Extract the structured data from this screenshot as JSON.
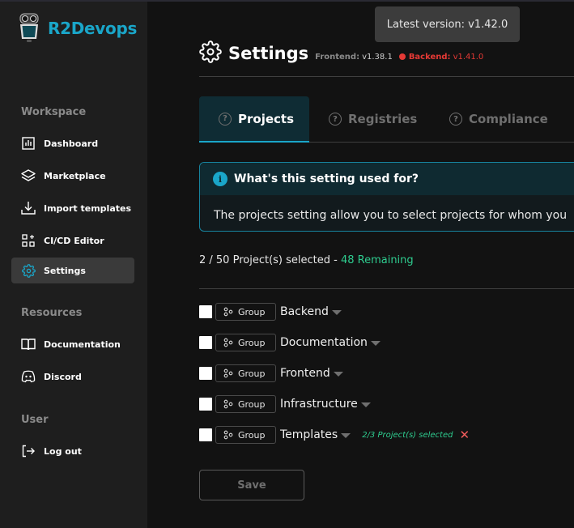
{
  "app": {
    "name": "R2Devops"
  },
  "sidebar": {
    "sections": [
      {
        "title": "Workspace"
      },
      {
        "title": "Resources"
      },
      {
        "title": "User"
      }
    ],
    "items": [
      {
        "label": "Dashboard",
        "icon": "chart-bar-icon"
      },
      {
        "label": "Marketplace",
        "icon": "layers-icon"
      },
      {
        "label": "Import templates",
        "icon": "download-icon"
      },
      {
        "label": "CI/CD Editor",
        "icon": "grid-plus-icon"
      },
      {
        "label": "Settings",
        "icon": "gear-icon",
        "active": true
      },
      {
        "label": "Documentation",
        "icon": "book-icon"
      },
      {
        "label": "Discord",
        "icon": "discord-icon"
      },
      {
        "label": "Log out",
        "icon": "logout-icon"
      }
    ]
  },
  "tooltip": {
    "text": "Latest version: v1.42.0"
  },
  "header": {
    "title": "Settings",
    "frontend_label": "Frontend:",
    "frontend_version": "v1.38.1",
    "backend_label": "Backend:",
    "backend_version": "v1.41.0",
    "backend_status_color": "#e53935"
  },
  "tabs": [
    {
      "label": "Projects",
      "active": true
    },
    {
      "label": "Registries",
      "active": false
    },
    {
      "label": "Compliance",
      "active": false
    }
  ],
  "info": {
    "title": "What's this setting used for?",
    "body": "The projects setting allow you to select projects for whom you"
  },
  "selection": {
    "summary": "2 / 50 Project(s) selected - ",
    "remaining": "48 Remaining"
  },
  "groups": [
    {
      "type": "Group",
      "name": "Backend",
      "checked": false,
      "note": ""
    },
    {
      "type": "Group",
      "name": "Documentation",
      "checked": false,
      "note": ""
    },
    {
      "type": "Group",
      "name": "Frontend",
      "checked": false,
      "note": ""
    },
    {
      "type": "Group",
      "name": "Infrastructure",
      "checked": false,
      "note": ""
    },
    {
      "type": "Group",
      "name": "Templates",
      "checked": false,
      "note": "2/3 Project(s) selected"
    }
  ],
  "save_label": "Save",
  "colors": {
    "accent": "#1aa6c9",
    "success": "#2ecc8f",
    "danger": "#e53935",
    "sidebar_bg": "#1e1e1e",
    "main_bg": "#121212"
  }
}
